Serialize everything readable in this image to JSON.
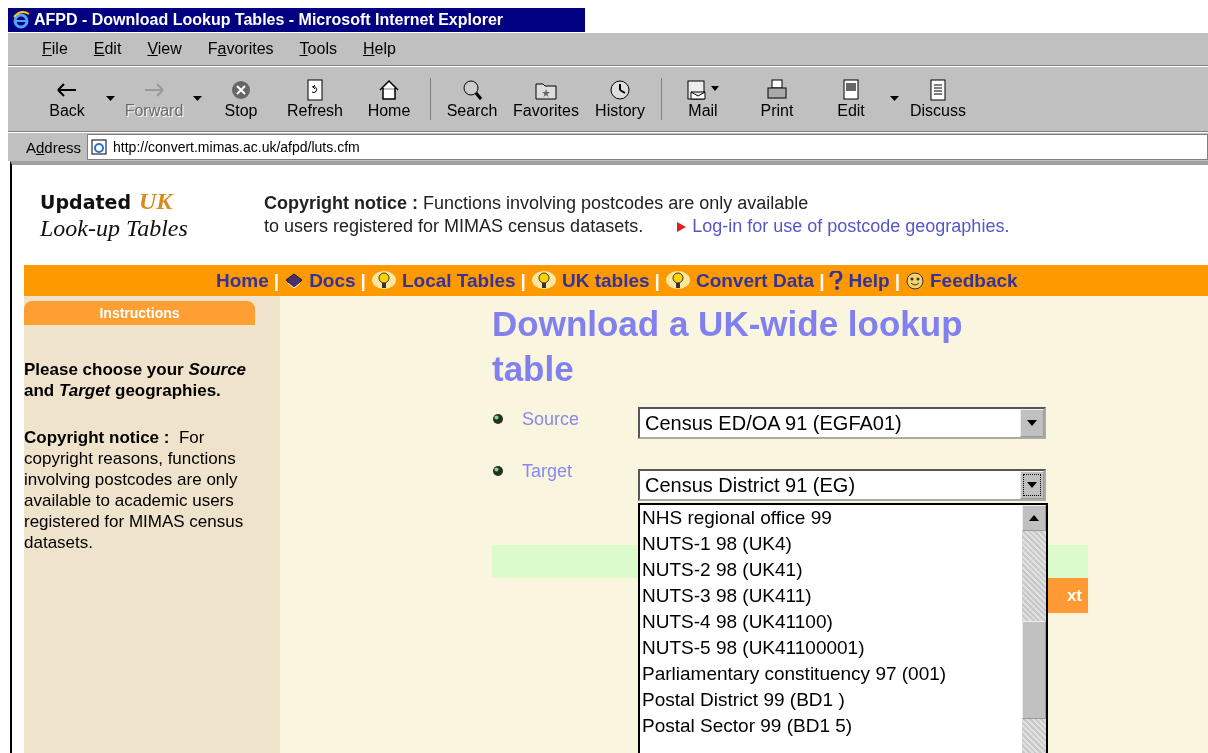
{
  "window": {
    "title": "AFPD - Download Lookup Tables - Microsoft Internet Explorer"
  },
  "menu": [
    {
      "key": "F",
      "post": "ile"
    },
    {
      "key": "E",
      "post": "dit"
    },
    {
      "key": "V",
      "post": "iew"
    },
    {
      "pre": "F",
      "key": "a",
      "post": "vorites"
    },
    {
      "key": "T",
      "post": "ools"
    },
    {
      "key": "H",
      "post": "elp"
    }
  ],
  "toolbar_groups": [
    {
      "buttons": [
        {
          "kind": "back",
          "label": "Back",
          "disabled": false,
          "dropdown": true
        },
        {
          "kind": "forward",
          "label": "Forward",
          "disabled": true,
          "dropdown": true
        },
        {
          "kind": "stop",
          "label": "Stop",
          "disabled": false,
          "dropdown": false
        },
        {
          "kind": "refresh",
          "label": "Refresh",
          "disabled": false,
          "dropdown": false
        },
        {
          "kind": "home",
          "label": "Home",
          "disabled": false,
          "dropdown": false
        }
      ]
    },
    {
      "buttons": [
        {
          "kind": "search",
          "label": "Search",
          "disabled": false,
          "dropdown": false
        },
        {
          "kind": "favorites",
          "label": "Favorites",
          "disabled": false,
          "dropdown": false
        },
        {
          "kind": "history",
          "label": "History",
          "disabled": false,
          "dropdown": false
        }
      ]
    },
    {
      "buttons": [
        {
          "kind": "mail",
          "label": "Mail",
          "disabled": false,
          "dropdown": false
        },
        {
          "kind": "print",
          "label": "Print",
          "disabled": false,
          "dropdown": false
        },
        {
          "kind": "edit",
          "label": "Edit",
          "disabled": false,
          "dropdown": true
        },
        {
          "kind": "discuss",
          "label": "Discuss",
          "disabled": false,
          "dropdown": false
        }
      ]
    }
  ],
  "address": {
    "pre": "A",
    "key": "d",
    "post": "dress",
    "url": "http://convert.mimas.ac.uk/afpd/luts.cfm"
  },
  "header": {
    "logo_top": "Updated",
    "logo_accent": "UK",
    "logo_bottom": "Look-up Tables",
    "notice_line1": "**Copyright notice :** Functions involving postcodes are only available",
    "notice_line2": "to users registered for MIMAS census datasets.",
    "login_link": "Log-in for use of postcode geographies."
  },
  "nav": [
    {
      "kind": "plain",
      "label": "Home"
    },
    {
      "kind": "book",
      "label": "Docs",
      "separator_before": "|"
    },
    {
      "kind": "bulb",
      "label": "Local Tables",
      "separator_before": "|"
    },
    {
      "kind": "bulb",
      "label": "UK tables",
      "separator_before": "|"
    },
    {
      "kind": "bulb",
      "label": "Convert Data",
      "separator_before": "|"
    },
    {
      "kind": "question",
      "label": "Help",
      "separator_before": "|"
    },
    {
      "kind": "smiley",
      "label": "Feedback",
      "separator_before": "|"
    }
  ],
  "sidebar": {
    "tab": "Instructions",
    "intro": "Please choose your *Source* and *Target* geographies.",
    "notice": "**Copyright notice :**  For copyright reasons, functions involving postcodes are only available to academic users registered for MIMAS census datasets."
  },
  "main": {
    "title": "Download a UK-wide lookup table",
    "fields": [
      {
        "label": "Source",
        "value": "Census ED/OA 91 (EGFA01)",
        "expanded": false
      },
      {
        "label": "Target",
        "value": "Census District 91 (EG)",
        "expanded": true
      }
    ],
    "options": [
      {
        "label": "NHS regional office 99",
        "selected": false
      },
      {
        "label": "NUTS-1 98 (UK4)",
        "selected": false
      },
      {
        "label": "NUTS-2 98 (UK41)",
        "selected": false
      },
      {
        "label": "NUTS-3 98 (UK411)",
        "selected": false
      },
      {
        "label": "NUTS-4 98 (UK41100)",
        "selected": false
      },
      {
        "label": "NUTS-5 98 (UK41100001)",
        "selected": false
      },
      {
        "label": "Parliamentary constituency 97 (001)",
        "selected": false
      },
      {
        "label": "Postal District 99 (BD1 )",
        "selected": false
      },
      {
        "label": "Postal Sector 99 (BD1 5)",
        "selected": false
      }
    ],
    "button": "xt"
  }
}
